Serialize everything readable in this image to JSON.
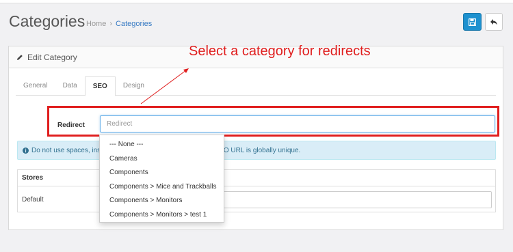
{
  "header": {
    "title": "Categories",
    "breadcrumb": {
      "home": "Home",
      "separator": "›",
      "current": "Categories"
    }
  },
  "toolbar": {
    "save_icon": "floppy-disk-icon",
    "back_icon": "reply-arrow-icon"
  },
  "panel": {
    "heading_icon": "pencil-icon",
    "heading": "Edit Category",
    "tabs": [
      {
        "label": "General"
      },
      {
        "label": "Data"
      },
      {
        "label": "SEO",
        "active": true
      },
      {
        "label": "Design"
      }
    ]
  },
  "redirect": {
    "label": "Redirect",
    "placeholder": "Redirect"
  },
  "annotation": {
    "text": "Select a category for redirects",
    "color": "#e01e1e"
  },
  "alert": {
    "icon": "info-circle-icon",
    "text_left": "Do not use spaces, inste",
    "text_right": "SEO URL is globally unique."
  },
  "stores": {
    "header": "Stores",
    "rows": [
      {
        "store": "Default",
        "value": ""
      }
    ]
  },
  "dropdown": {
    "options": [
      "--- None ---",
      "Cameras",
      "Components",
      "Components  >  Mice and Trackballs",
      "Components  >  Monitors",
      "Components  >  Monitors  >  test 1"
    ]
  },
  "colors": {
    "primary": "#1e91cf",
    "link": "#3a7cc4",
    "annotation": "#e01e1e",
    "alert_bg": "#d9edf7"
  }
}
